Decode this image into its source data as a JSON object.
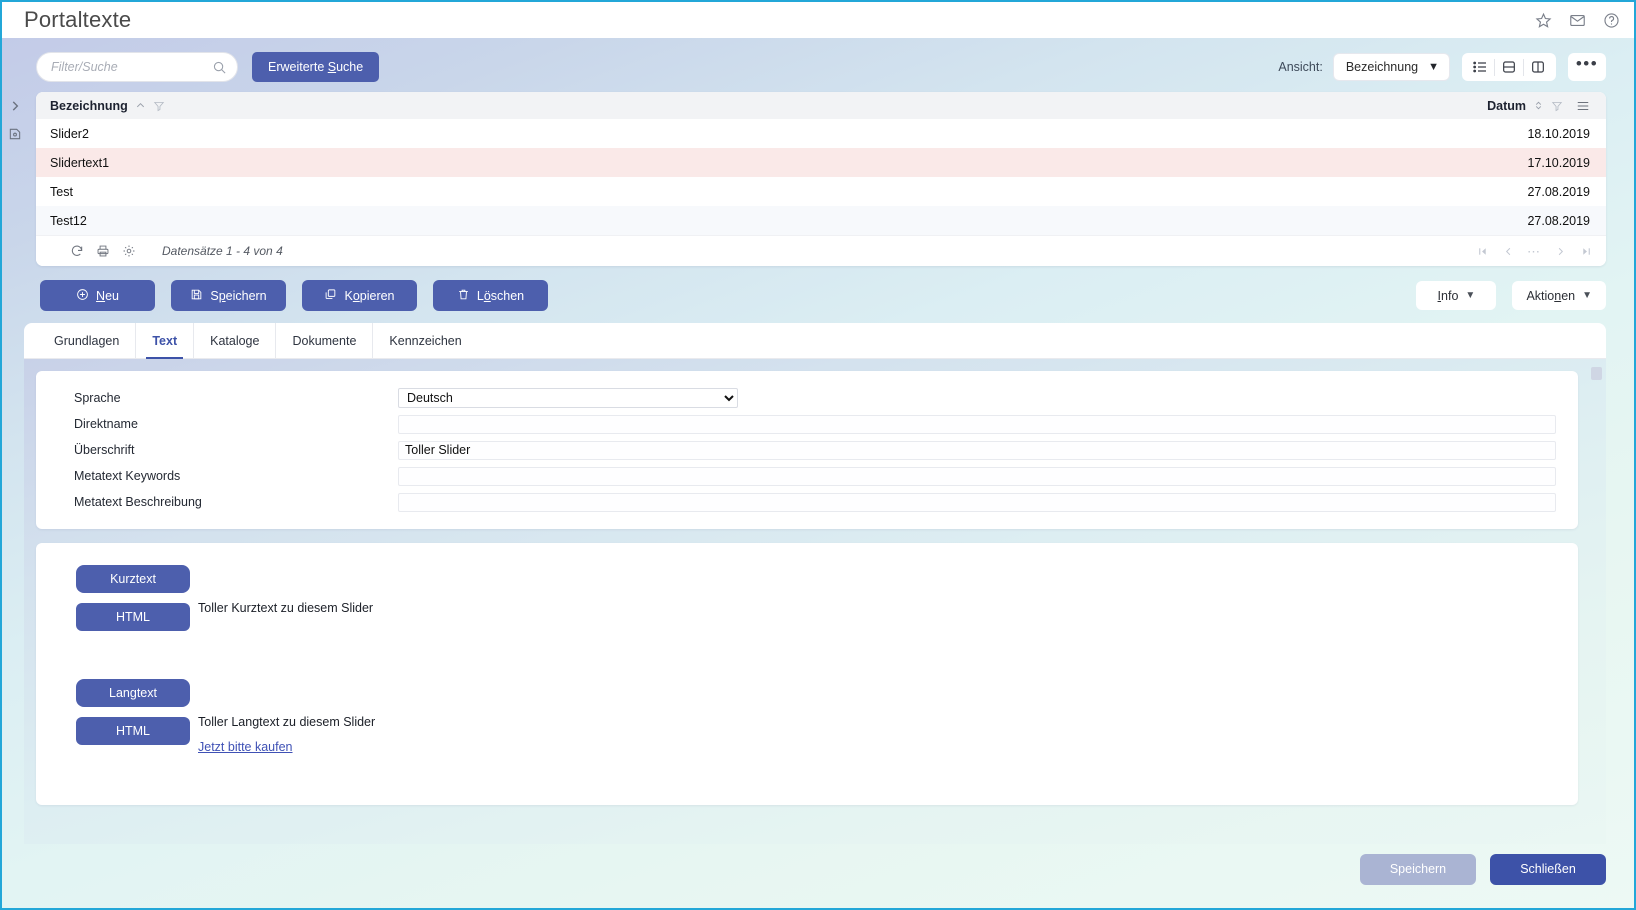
{
  "window": {
    "title": "Portaltexte",
    "icons": [
      {
        "name": "favorite-star-icon"
      },
      {
        "name": "mail-icon"
      },
      {
        "name": "help-icon"
      }
    ]
  },
  "search": {
    "placeholder": "Filter/Suche",
    "value": "",
    "advanced_label_pre": "Erweiterte ",
    "advanced_label_acc": "S",
    "advanced_label_post": "uche"
  },
  "view": {
    "label": "Ansicht:",
    "selected": "Bezeichnung",
    "options": [
      "Bezeichnung"
    ],
    "buttons": [
      {
        "name": "list-view-icon"
      },
      {
        "name": "split-horizontal-view-icon"
      },
      {
        "name": "split-vertical-view-icon"
      }
    ],
    "more_label": "•••"
  },
  "grid": {
    "columns": [
      {
        "key": "bezeichnung",
        "label": "Bezeichnung",
        "sort": "asc"
      },
      {
        "key": "datum",
        "label": "Datum",
        "sort": "none"
      }
    ],
    "rows": [
      {
        "bezeichnung": "Slider2",
        "datum": "18.10.2019",
        "selected": false
      },
      {
        "bezeichnung": "Slidertext1",
        "datum": "17.10.2019",
        "selected": true
      },
      {
        "bezeichnung": "Test",
        "datum": "27.08.2019",
        "selected": false
      },
      {
        "bezeichnung": "Test12",
        "datum": "27.08.2019",
        "selected": false
      }
    ],
    "footer": {
      "count_text": "Datensätze 1 - 4 von 4",
      "icons": [
        {
          "name": "refresh-icon"
        },
        {
          "name": "print-icon"
        },
        {
          "name": "settings-gear-icon"
        }
      ],
      "pager": [
        "first-page-icon",
        "prev-page-icon",
        "page-dots",
        "next-page-icon",
        "last-page-icon"
      ]
    }
  },
  "toolbar": {
    "buttons": [
      {
        "name": "new-button",
        "icon": "plus-circle-icon",
        "pre": "",
        "acc": "N",
        "post": "eu"
      },
      {
        "name": "save-button",
        "icon": "save-disk-icon",
        "pre": "S",
        "acc": "p",
        "post": "eichern"
      },
      {
        "name": "copy-button",
        "icon": "copy-icon",
        "pre": "K",
        "acc": "o",
        "post": "pieren"
      },
      {
        "name": "delete-button",
        "icon": "trash-icon",
        "pre": "L",
        "acc": "ö",
        "post": "schen"
      }
    ],
    "info_pre": "",
    "info_acc": "I",
    "info_post": "nfo",
    "aktionen_pre": "Aktio",
    "aktionen_acc": "n",
    "aktionen_post": "en"
  },
  "tabs": [
    {
      "label": "Grundlagen",
      "active": false
    },
    {
      "label": "Text",
      "active": true
    },
    {
      "label": "Kataloge",
      "active": false
    },
    {
      "label": "Dokumente",
      "active": false
    },
    {
      "label": "Kennzeichen",
      "active": false
    }
  ],
  "form": {
    "fields": [
      {
        "label": "Sprache",
        "type": "select",
        "value": "Deutsch",
        "options": [
          "Deutsch"
        ]
      },
      {
        "label": "Direktname",
        "type": "text",
        "value": ""
      },
      {
        "label": "Überschrift",
        "type": "text",
        "value": "Toller Slider"
      },
      {
        "label": "Metatext Keywords",
        "type": "text",
        "value": ""
      },
      {
        "label": "Metatext Beschreibung",
        "type": "text",
        "value": ""
      }
    ]
  },
  "textblocks": [
    {
      "title_button": "Kurztext",
      "html_button": "HTML",
      "lines": [
        "Toller Kurztext zu diesem Slider"
      ],
      "link": ""
    },
    {
      "title_button": "Langtext",
      "html_button": "HTML",
      "lines": [
        "Toller Langtext zu diesem Slider"
      ],
      "link": "Jetzt bitte kaufen"
    }
  ],
  "footer": {
    "save_label": "Speichern",
    "close_label": "Schließen"
  },
  "colors": {
    "accent_blue": "#4d5fad",
    "primary_blue": "#3d52a8",
    "border_cyan": "#23a7d8",
    "selected_row": "#fae9e8"
  }
}
